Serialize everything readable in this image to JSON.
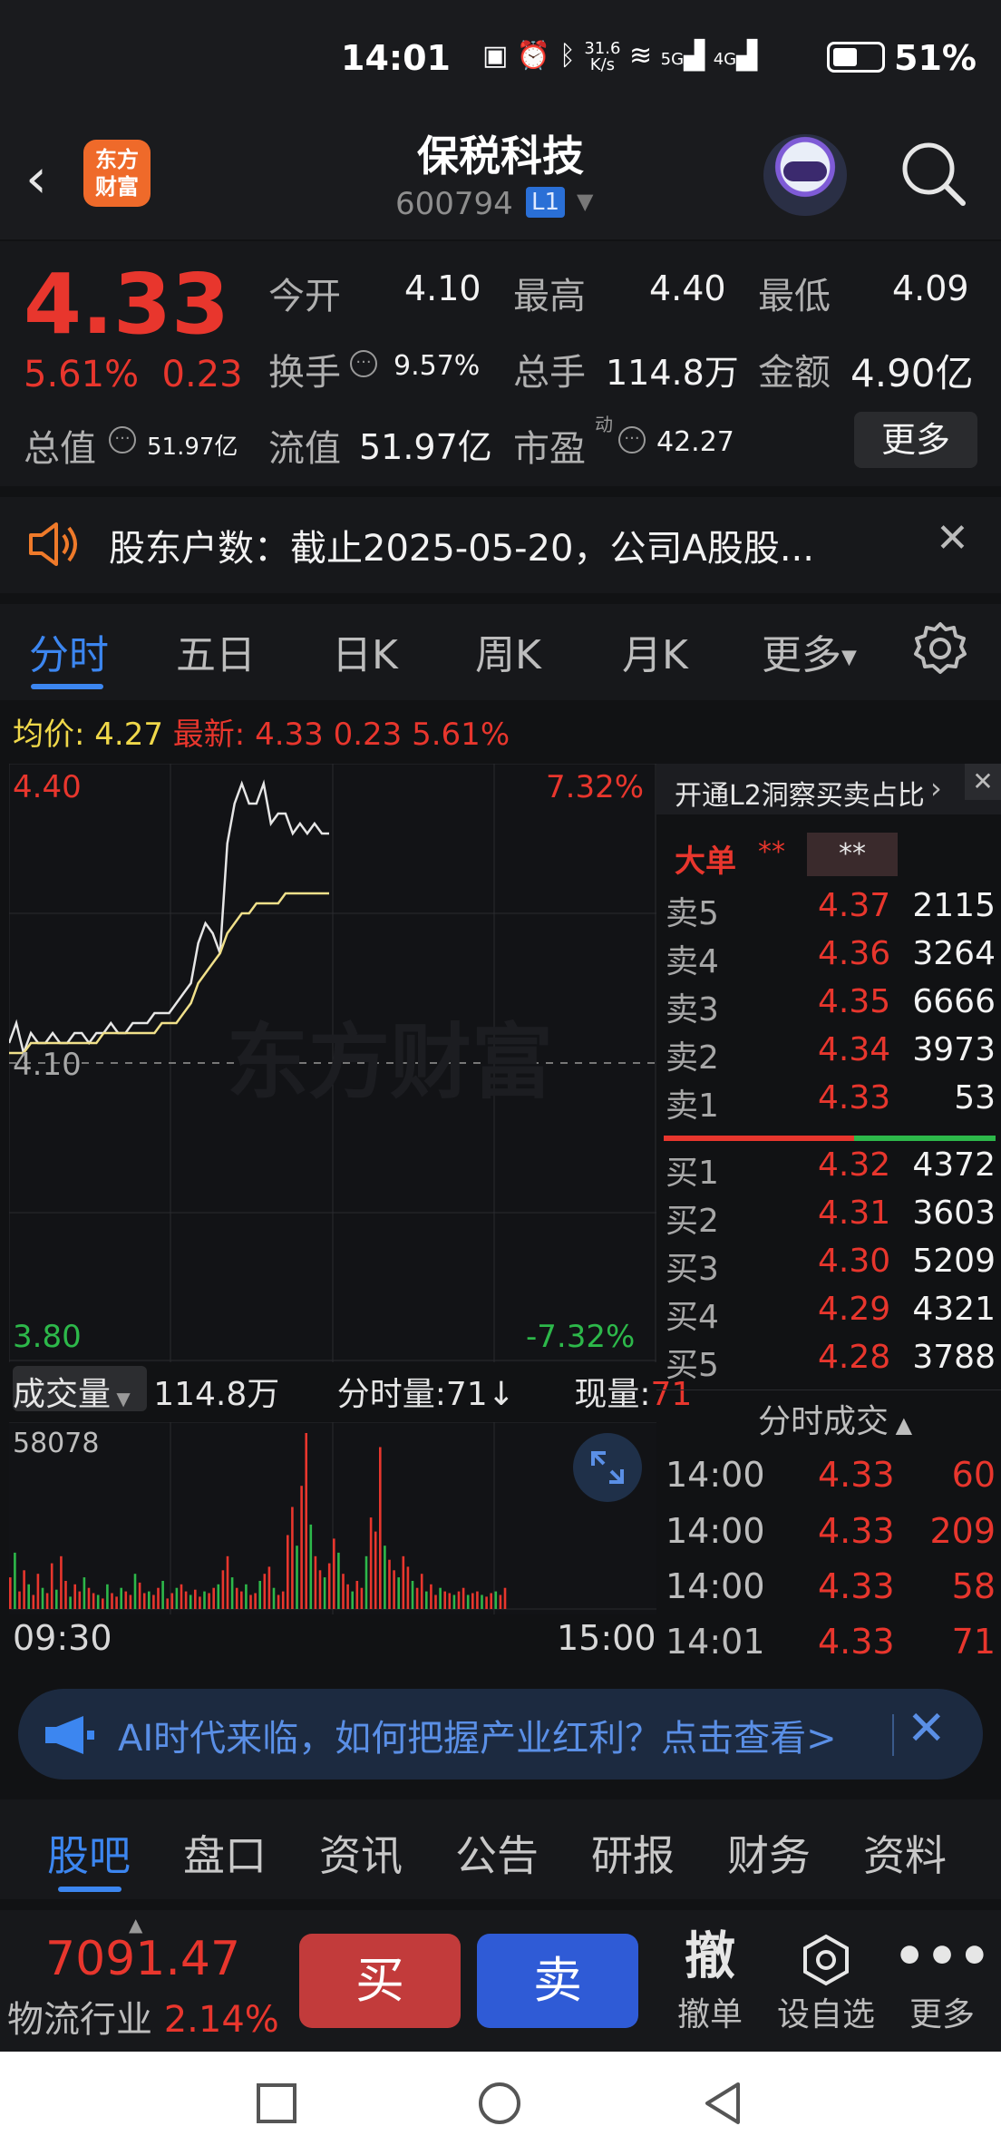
{
  "status_bar": {
    "time": "14:01",
    "net_speed_top": "31.6",
    "net_speed_unit": "K/s",
    "signal_5g": "5G",
    "signal_4g": "4G",
    "battery": "51%"
  },
  "header": {
    "logo_line1": "东方",
    "logo_line2": "财富",
    "stock_name": "保税科技",
    "stock_code": "600794",
    "level_badge": "L1"
  },
  "quote": {
    "price": "4.33",
    "change_pct": "5.61%",
    "change_amt": "0.23",
    "open_label": "今开",
    "open": "4.10",
    "high_label": "最高",
    "high": "4.40",
    "low_label": "最低",
    "low": "4.09",
    "turnover_label": "换手",
    "turnover": "9.57%",
    "volume_label": "总手",
    "volume": "114.8万",
    "amount_label": "金额",
    "amount": "4.90亿",
    "mktcap_label": "总值",
    "mktcap": "51.97亿",
    "float_label": "流值",
    "float_cap": "51.97亿",
    "pe_label": "市盈",
    "pe_sup": "动",
    "pe": "42.27",
    "more": "更多"
  },
  "notice": {
    "text": "股东户数：截止2025-05-20，公司A股股..."
  },
  "chart_tabs": [
    "分时",
    "五日",
    "日K",
    "周K",
    "月K",
    "更多"
  ],
  "avg_bar": {
    "avg_label": "均价:",
    "avg": "4.27",
    "last_label": "最新:",
    "last": "4.33",
    "chg": "0.23",
    "pct": "5.61%"
  },
  "chart_data": {
    "type": "line",
    "title": "",
    "y_max_label": "4.40",
    "y_mid_label": "4.10",
    "y_min_label": "3.80",
    "pct_max_label": "7.32%",
    "pct_min_label": "-7.32%",
    "ylim": [
      3.8,
      4.4
    ],
    "prev_close": 4.1,
    "watermark": "东方财富",
    "series": [
      {
        "values": [
          4.12,
          4.14,
          4.11,
          4.13,
          4.12,
          4.12,
          4.13,
          4.12,
          4.12,
          4.13,
          4.13,
          4.12,
          4.13,
          4.13,
          4.14,
          4.13,
          4.13,
          4.14,
          4.14,
          4.14,
          4.15,
          4.15,
          4.15,
          4.16,
          4.17,
          4.18,
          4.22,
          4.24,
          4.23,
          4.21,
          4.32,
          4.36,
          4.38,
          4.36,
          4.36,
          4.38,
          4.34,
          4.35,
          4.35,
          4.33,
          4.34,
          4.33,
          4.34,
          4.33,
          4.33
        ]
      },
      {
        "values": [
          4.11,
          4.11,
          4.11,
          4.12,
          4.12,
          4.12,
          4.12,
          4.12,
          4.12,
          4.12,
          4.12,
          4.12,
          4.12,
          4.13,
          4.13,
          4.13,
          4.13,
          4.13,
          4.13,
          4.13,
          4.13,
          4.14,
          4.14,
          4.14,
          4.15,
          4.16,
          4.18,
          4.19,
          4.2,
          4.21,
          4.23,
          4.24,
          4.25,
          4.25,
          4.26,
          4.26,
          4.26,
          4.26,
          4.27,
          4.27,
          4.27,
          4.27,
          4.27,
          4.27,
          4.27
        ]
      }
    ]
  },
  "volume": {
    "selector": "成交量",
    "total": "114.8万",
    "tick_vol_label": "分时量:",
    "tick_vol": "71",
    "now_vol_label": "现量:",
    "now_vol": "71",
    "max_label": "58078",
    "bars": [
      18,
      32,
      10,
      22,
      14,
      8,
      20,
      12,
      9,
      26,
      11,
      30,
      16,
      7,
      14,
      10,
      18,
      12,
      9,
      8,
      6,
      14,
      9,
      7,
      12,
      10,
      8,
      20,
      15,
      9,
      10,
      8,
      12,
      16,
      6,
      9,
      12,
      14,
      10,
      8,
      11,
      7,
      10,
      9,
      12,
      14,
      22,
      30,
      18,
      12,
      10,
      14,
      8,
      9,
      16,
      20,
      24,
      12,
      8,
      10,
      42,
      58,
      36,
      70,
      100,
      48,
      30,
      22,
      18,
      26,
      40,
      32,
      20,
      14,
      10,
      16,
      12,
      30,
      52,
      44,
      92,
      36,
      28,
      22,
      18,
      30,
      24,
      16,
      12,
      20,
      10,
      14,
      8,
      12,
      10,
      9,
      8,
      10,
      12,
      8,
      9,
      10,
      8,
      7,
      9,
      10,
      8,
      12
    ],
    "colors": [
      "r",
      "g",
      "r",
      "r",
      "g",
      "r",
      "r",
      "g",
      "r",
      "r",
      "g",
      "r",
      "r",
      "g",
      "r",
      "r",
      "g",
      "r",
      "r",
      "g",
      "r",
      "g",
      "r",
      "r",
      "g",
      "r",
      "r",
      "g",
      "r",
      "r",
      "g",
      "r",
      "r",
      "g",
      "r",
      "r",
      "g",
      "r",
      "r",
      "g",
      "r",
      "r",
      "g",
      "r",
      "r",
      "g",
      "r",
      "r",
      "g",
      "r",
      "r",
      "g",
      "r",
      "r",
      "g",
      "r",
      "r",
      "g",
      "r",
      "r",
      "r",
      "r",
      "g",
      "r",
      "r",
      "g",
      "r",
      "r",
      "g",
      "r",
      "r",
      "g",
      "r",
      "r",
      "g",
      "r",
      "r",
      "g",
      "r",
      "r",
      "r",
      "g",
      "r",
      "r",
      "g",
      "r",
      "r",
      "g",
      "r",
      "r",
      "g",
      "r",
      "r",
      "g",
      "r",
      "r",
      "g",
      "r",
      "r",
      "g",
      "r",
      "r",
      "g",
      "r",
      "r",
      "g",
      "r",
      "r"
    ],
    "time_start": "09:30",
    "time_end": "15:00"
  },
  "orderbook": {
    "promo": "开通L2洞察买卖占比",
    "big_label": "大单",
    "masked1": "**",
    "masked2": "**",
    "asks": [
      {
        "name": "卖5",
        "price": "4.37",
        "vol": "2115"
      },
      {
        "name": "卖4",
        "price": "4.36",
        "vol": "3264"
      },
      {
        "name": "卖3",
        "price": "4.35",
        "vol": "6666"
      },
      {
        "name": "卖2",
        "price": "4.34",
        "vol": "3973"
      },
      {
        "name": "卖1",
        "price": "4.33",
        "vol": "53"
      }
    ],
    "bids": [
      {
        "name": "买1",
        "price": "4.32",
        "vol": "4372"
      },
      {
        "name": "买2",
        "price": "4.31",
        "vol": "3603"
      },
      {
        "name": "买3",
        "price": "4.30",
        "vol": "5209"
      },
      {
        "name": "买4",
        "price": "4.29",
        "vol": "4321"
      },
      {
        "name": "买5",
        "price": "4.28",
        "vol": "3788"
      }
    ],
    "ticks_title": "分时成交",
    "ticks": [
      {
        "t": "14:00",
        "p": "4.33",
        "v": "60"
      },
      {
        "t": "14:00",
        "p": "4.33",
        "v": "209"
      },
      {
        "t": "14:00",
        "p": "4.33",
        "v": "58"
      },
      {
        "t": "14:01",
        "p": "4.33",
        "v": "71"
      }
    ]
  },
  "ad": {
    "text": "AI时代来临，如何把握产业红利？点击查看>"
  },
  "bottom_tabs": [
    "股吧",
    "盘口",
    "资讯",
    "公告",
    "研报",
    "财务",
    "资料"
  ],
  "trade_bar": {
    "index_value": "7091.47",
    "index_name": "物流行业",
    "index_pct": "2.14%",
    "buy": "买",
    "sell": "卖",
    "cancel_icon": "撤",
    "cancel": "撤单",
    "watchlist": "设自选",
    "more": "更多"
  },
  "colors": {
    "up": "#e8362d",
    "down": "#2db84a",
    "accent": "#3c86f0",
    "avg_line": "#f0e08a"
  }
}
